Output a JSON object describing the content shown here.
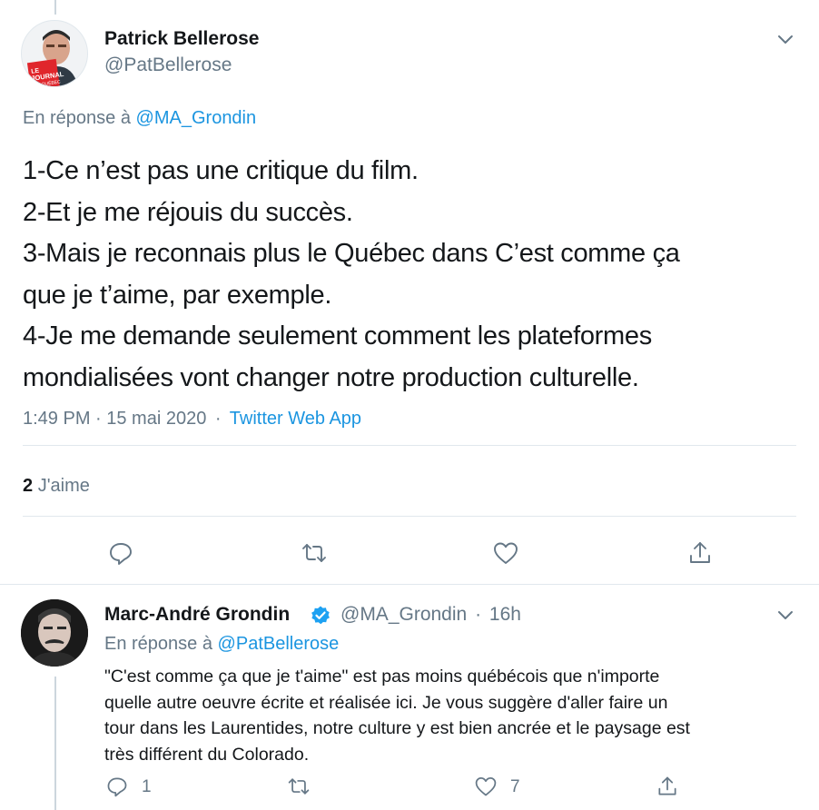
{
  "tweet": {
    "author_name": "Patrick Bellerose",
    "author_handle": "@PatBellerose",
    "avatar_badge": [
      "LE",
      "JOURNAL",
      "DE QUÉBEC"
    ],
    "reply_prefix": "En réponse à",
    "reply_to": "@MA_Grondin",
    "lines": [
      "1-Ce n’est pas une critique du film.",
      "2-Et je me réjouis du succès.",
      "3-Mais je reconnais plus le Québec dans C’est comme ça",
      "que je t’aime, par exemple.",
      "4-Je me demande seulement comment les plateformes",
      "mondialisées vont changer notre production culturelle."
    ],
    "time": "1:49 PM · 15 mai 2020",
    "separator": "·",
    "source": "Twitter Web App",
    "likes_count": "2",
    "likes_label": "J'aime"
  },
  "reply": {
    "author_name": "Marc-André Grondin",
    "author_handle": "@MA_Grondin",
    "separator": "·",
    "age": "16h",
    "reply_prefix": "En réponse à",
    "reply_to": "@PatBellerose",
    "lines": [
      "\"C'est comme ça que je t'aime\" est pas moins québécois que n'importe",
      "quelle autre oeuvre écrite et réalisée ici. Je vous suggère d'aller faire un",
      "tour dans les Laurentides, notre culture y est bien ancrée et le paysage est",
      "très différent du Colorado."
    ],
    "reply_count": "1",
    "like_count": "7"
  },
  "colors": {
    "text": "#14171a",
    "secondary": "#657786",
    "link": "#1b95e0",
    "divider": "#e1e8ed",
    "thread_line": "#ccd6dd",
    "verified": "#1da1f2"
  },
  "icons": [
    "chevron-down-icon",
    "reply-icon",
    "retweet-icon",
    "heart-icon",
    "share-icon",
    "verified-badge-icon"
  ]
}
